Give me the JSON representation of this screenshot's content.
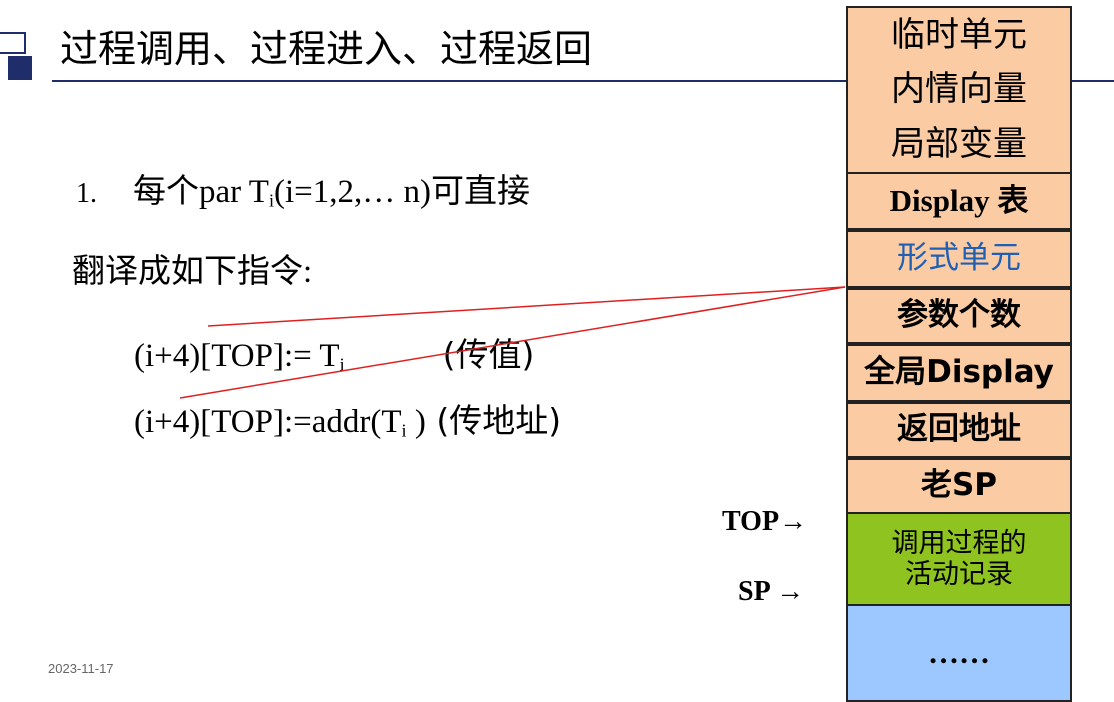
{
  "title": "过程调用、过程进入、过程返回",
  "body": {
    "line1": {
      "num": "1.",
      "pre": "每个",
      "par": "par T",
      "sub": "i",
      "post": "(i=1,2,… n)",
      "tail": "可直接"
    },
    "line2": {
      "text": "翻译成如下指令",
      "colon": ":"
    },
    "line3": {
      "expr": "(i+4)[TOP]:= T",
      "sub": "i",
      "note": "(传值)"
    },
    "line4": {
      "expr": "(i+4)[TOP]:=addr(T",
      "sub": "i",
      "close": " )",
      "note": " (传地址)"
    }
  },
  "date": "2023-11-17",
  "stack": {
    "temp": "临时单元",
    "inner": "内情向量",
    "local": "局部变量",
    "display": "Display 表",
    "formal": "形式单元",
    "param_count": "参数个数",
    "global_display": "全局Display",
    "return_addr": "返回地址",
    "old_sp": "老SP",
    "caller_line1": "调用过程的",
    "caller_line2": "活动记录",
    "rest": "……"
  },
  "labels": {
    "top": "TOP→",
    "sp": "SP →"
  },
  "colors": {
    "accent": "#1f2d6b",
    "cell": "#fbcca4",
    "caller": "#8fc31f",
    "rest": "#9cc8ff",
    "formal_text": "#1f5fb4",
    "link": "#e02020"
  }
}
